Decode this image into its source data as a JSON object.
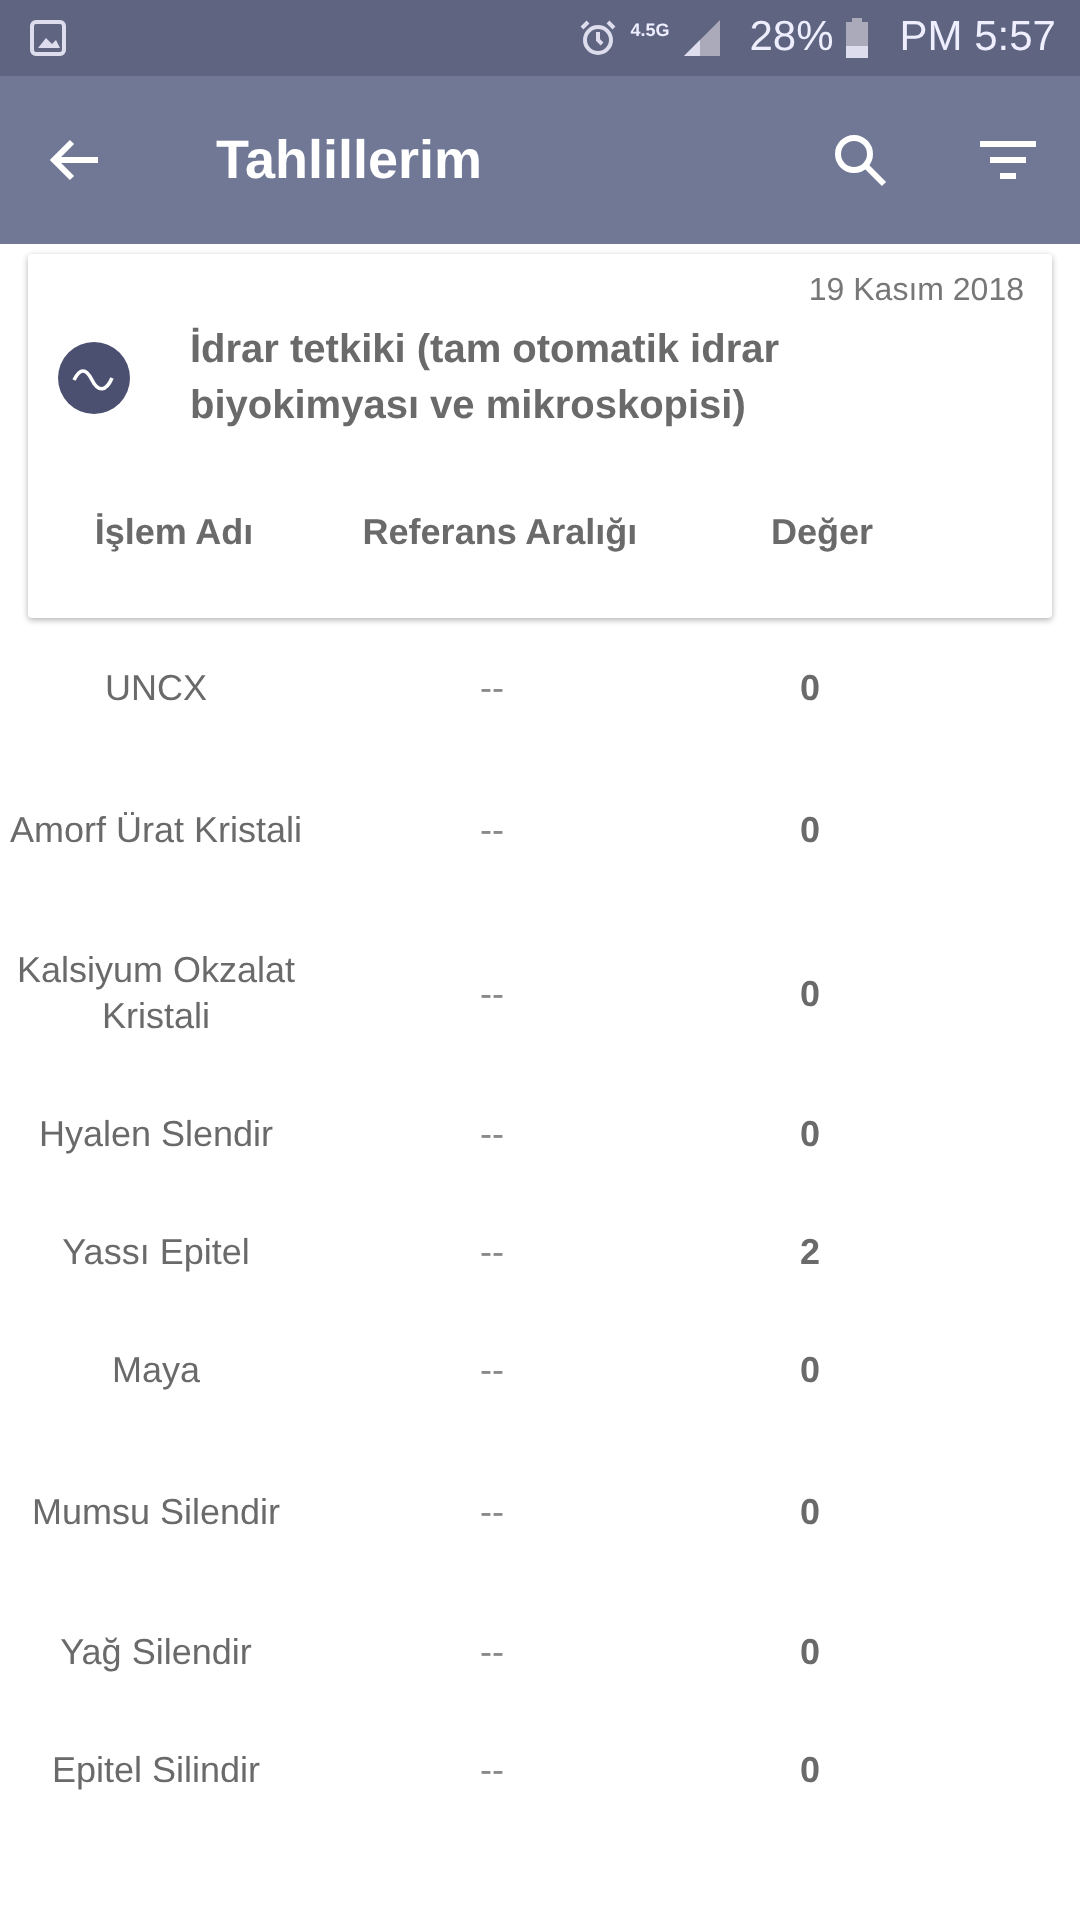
{
  "status_bar": {
    "network": "4.5G",
    "battery": "28%",
    "time": "PM 5:57"
  },
  "app_bar": {
    "title": "Tahlillerim"
  },
  "card": {
    "date": "19 Kasım 2018",
    "title": "İdrar tetkiki (tam otomatik idrar biyokimyası ve mikroskopisi)"
  },
  "table": {
    "columns": [
      "İşlem Adı",
      "Referans Aralığı",
      "Değer"
    ],
    "rows": [
      {
        "name": "UNCX",
        "range": "--",
        "value": "0"
      },
      {
        "name": "Amorf Ürat Kristali",
        "range": "--",
        "value": "0"
      },
      {
        "name": "Kalsiyum Okzalat Kristali",
        "range": "--",
        "value": "0"
      },
      {
        "name": "Hyalen Slendir",
        "range": "--",
        "value": "0"
      },
      {
        "name": "Yassı Epitel",
        "range": "--",
        "value": "2"
      },
      {
        "name": "Maya",
        "range": "--",
        "value": "0"
      },
      {
        "name": "Mumsu Silendir",
        "range": "--",
        "value": "0"
      },
      {
        "name": "Yağ Silendir",
        "range": "--",
        "value": "0"
      },
      {
        "name": "Epitel Silindir",
        "range": "--",
        "value": "0"
      }
    ]
  }
}
